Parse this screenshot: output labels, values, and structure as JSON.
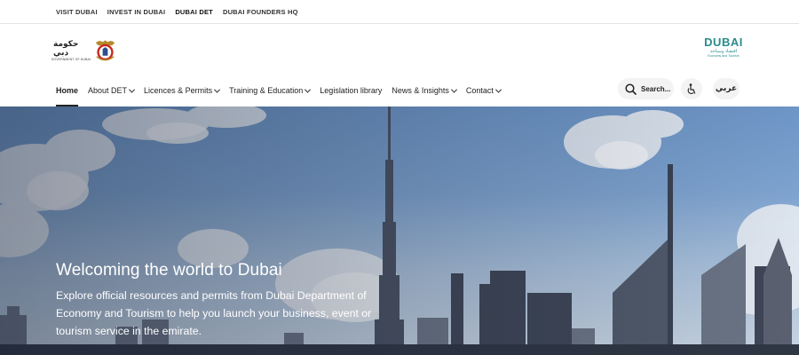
{
  "topbar": {
    "links": [
      "VISIT DUBAI",
      "INVEST IN DUBAI",
      "DUBAI DET",
      "DUBAI FOUNDERS HQ"
    ]
  },
  "logos": {
    "gov_ar": "حكومة دبي",
    "gov_en": "GOVERNMENT OF DUBAI",
    "det_title": "DUBAI",
    "det_ar": "اقتصاد وسياحة",
    "det_en": "Economy and Tourism"
  },
  "nav": {
    "items": [
      {
        "label": "Home",
        "dropdown": false,
        "active": true
      },
      {
        "label": "About DET",
        "dropdown": true
      },
      {
        "label": "Licences & Permits",
        "dropdown": true
      },
      {
        "label": "Training & Education",
        "dropdown": true
      },
      {
        "label": "Legislation library",
        "dropdown": false
      },
      {
        "label": "News & Insights",
        "dropdown": true
      },
      {
        "label": "Contact",
        "dropdown": true
      }
    ],
    "search_label": "Search...",
    "language_label": "عربي"
  },
  "hero": {
    "title": "Welcoming the world to Dubai",
    "description": "Explore official resources and permits from Dubai Department of Economy and Tourism to help you launch your business, event or tourism service in the emirate."
  },
  "colors": {
    "brand_teal": "#2b8c8c",
    "emblem_red": "#c8281e",
    "sky_top": "#6d95c6"
  },
  "icons": [
    "search-icon",
    "accessibility-icon",
    "chevron-down-icon",
    "dubai-emblem-icon"
  ]
}
